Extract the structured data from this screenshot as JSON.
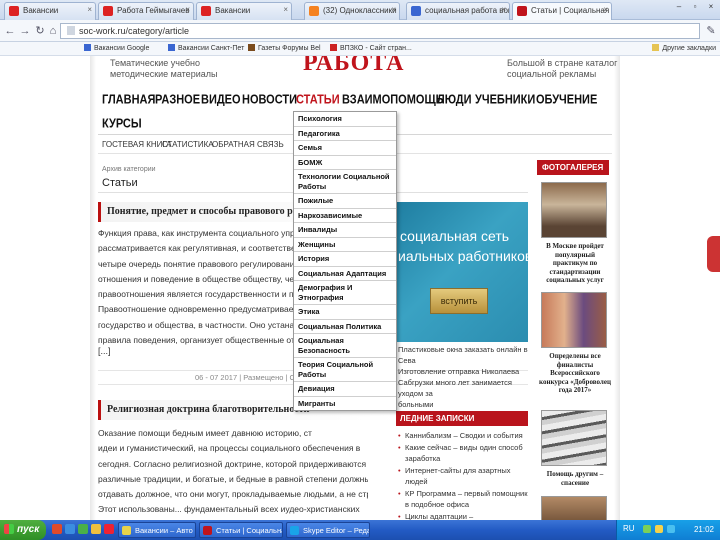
{
  "browser": {
    "tabs": [
      {
        "label": "Вакансии",
        "icon": "mail-icon",
        "color": "#d22"
      },
      {
        "label": "Работа Геймыгачев",
        "icon": "mail-icon",
        "color": "#d22"
      },
      {
        "label": "Вакансии",
        "icon": "mail-icon",
        "color": "#d22"
      },
      {
        "label": "(32) Одноклассники",
        "icon": "ok-icon",
        "color": "#f58220"
      },
      {
        "label": "социальная работа вопрос",
        "icon": "search-icon",
        "color": "#3a66d1"
      },
      {
        "label": "Статьи | Социальная работа",
        "icon": "site-icon",
        "color": "#c0141c"
      }
    ],
    "url": "soc-work.ru/category/article",
    "bookmarks": [
      "Вакансии Google",
      "Вакансии Санкт-Пет",
      "Газеты Форумы Bel",
      "ВПЗКО - Сайт стран..."
    ],
    "bookmarks_right": "Другие закладки"
  },
  "site": {
    "header_left": [
      "Тематические учебно",
      "методические материалы"
    ],
    "logo": "РАБОТА",
    "header_right": [
      "Большой в стране каталог",
      "социальной рекламы"
    ],
    "main_nav": [
      "ГЛАВНАЯ",
      "РАЗНОЕ",
      "ВИДЕО",
      "НОВОСТИ",
      "СТАТЬИ",
      "ВЗАИМОПОМОЩЬ",
      "ЛЮДИ",
      "УЧЕБНИКИ",
      "ОБУЧЕНИЕ",
      "КУРСЫ"
    ],
    "active_nav": "СТАТЬИ",
    "sub_nav": [
      "ГОСТЕВАЯ КНИГА",
      "СТАТИСТИКА",
      "ОБРАТНАЯ СВЯЗЬ"
    ],
    "archive_label": "Архив категории",
    "archive_title": "Статьи",
    "dropdown": [
      "Психология",
      "Педагогика",
      "Семья",
      "БОМЖ",
      "Технологии Социальной Работы",
      "Пожилые",
      "Наркозависимые",
      "Инвалиды",
      "Женщины",
      "История",
      "Социальная Адаптация",
      "Демография И Этнография",
      "Этика",
      "Социальная Политика",
      "Социальная Безопасность",
      "Теория Социальной Работы",
      "Девиация",
      "Мигранты"
    ],
    "posts": [
      {
        "title": "Понятие, предмет и способы правового регулирования",
        "lines": [
          "Функция права, как инструмента социального управле",
          "рассматривается как регулятивная, и соответственно с",
          "четыре очередь понятие правового регулирования. СО",
          "отношения и поведение в обществе обществу, чего ж",
          "правоотношения является государственности и права. ",
          "Правоотношение одновременно предусматривает и п",
          "государство и общества, в частности. Оно устанавлива",
          "правила поведения, организует общественные отноше"
        ],
        "more": "[...]",
        "meta": "06 - 07 2017 | Размещено | Ст"
      },
      {
        "title": "Религиозная доктрина благотворительности",
        "lines": [
          "Оказание помощи бедным имеет давнюю историю, ст",
          "идеи и гуманистический, на процессы социального обеспечения в",
          "сегодня. Согласно религиозной доктрине, которой придерживаются",
          "различные традиции, и богатые, и бедные в равной степени должны",
          "отдавать должное, что они могут, прокладываемые людьми, а не страхом.",
          "Этот использованы... фундаментальный всех иудео-христианских"
        ]
      }
    ],
    "banner": {
      "line1": "социальная сеть",
      "line2": "иальных работников",
      "button": "вступить"
    },
    "ad_text": [
      "Пластиковые окна заказать онлайн в Сева",
      "Изготовление отправка Николаева",
      "Сабгрузки много лет занимается уходом за",
      "больными"
    ],
    "notes_header": "ЛЕДНИЕ ЗАПИСКИ",
    "notes": [
      "Каннибализм – Сводки и события",
      "Какие сейчас – виды один способ заработка",
      "Интернет-сайты для азартных людей",
      "КР Программа – первый помощник в подобное офиса",
      "Циклы адаптации – проникновение транспорта..."
    ],
    "gallery_header": "ФОТОГАЛЕРЕЯ",
    "captions": [
      "В Москве пройдет популярный практикум по стандартизации социальных услуг",
      "Определены все финалисты Всероссийского конкурса «Доброволец года 2017»",
      "Помощь другим – спасение"
    ]
  },
  "taskbar": {
    "start": "пуск",
    "tasks": [
      "Вакансии – Авто",
      "Статьи | Социальна...",
      "Skype Editor – Редакт..."
    ],
    "lang": "RU",
    "clock": "21:02"
  }
}
